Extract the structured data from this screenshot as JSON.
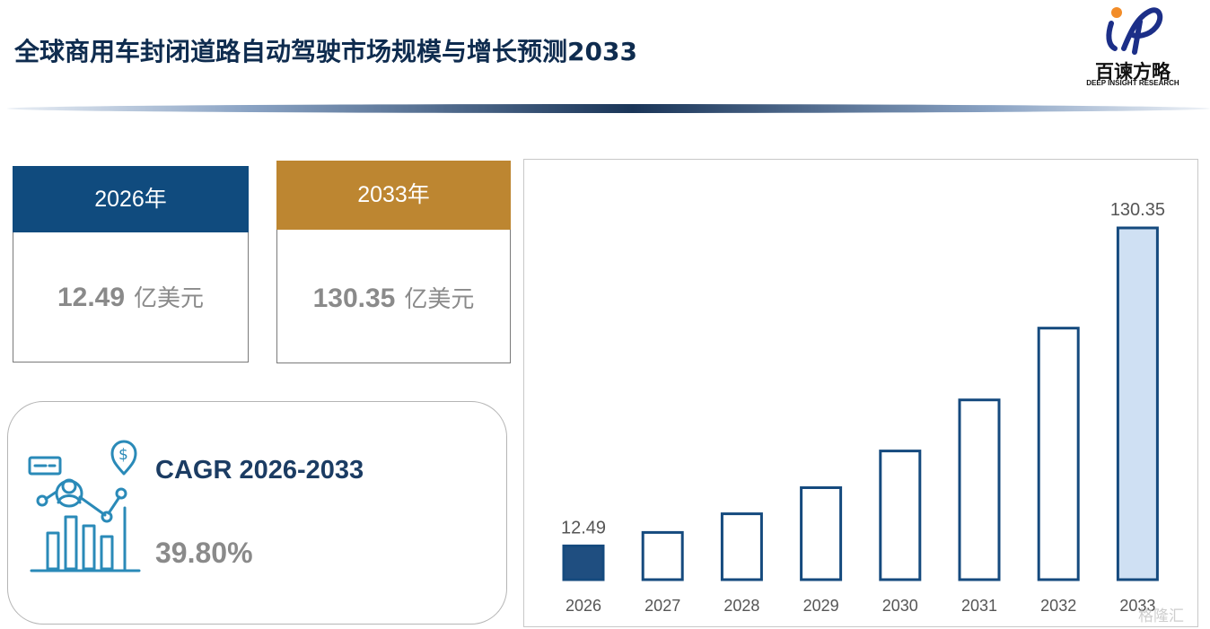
{
  "header": {
    "title": "全球商用车封闭道路自动驾驶市场规模与增长预测2033"
  },
  "logo": {
    "name_cn": "百谏方略",
    "name_en": "DEEP INSIGHT RESEARCH"
  },
  "cards": {
    "start": {
      "year_label": "2026年",
      "value": "12.49",
      "unit": "亿美元"
    },
    "end": {
      "year_label": "2033年",
      "value": "130.35",
      "unit": "亿美元"
    }
  },
  "cagr": {
    "label": "CAGR 2026-2033",
    "value": "39.80%"
  },
  "watermark": {
    "text": "格隆汇"
  },
  "colors": {
    "navy": "#104b7e",
    "gold": "#bd8631",
    "bar_outline": "#154a7e",
    "bar_first_fill": "#1f4e80",
    "bar_last_fill": "#cfe0f3",
    "value_gray": "#8a8a8a"
  },
  "chart_data": {
    "type": "bar",
    "categories": [
      "2026",
      "2027",
      "2028",
      "2029",
      "2030",
      "2031",
      "2032",
      "2033"
    ],
    "values": [
      12.49,
      17.5,
      24.4,
      34.1,
      47.7,
      66.6,
      93.2,
      130.35
    ],
    "data_labels": [
      "12.49",
      "",
      "",
      "",
      "",
      "",
      "",
      "130.35"
    ],
    "highlight": {
      "first": "filled-navy",
      "last": "filled-light-blue",
      "others": "outline"
    },
    "title": "",
    "xlabel": "",
    "ylabel": "",
    "ylim": [
      0,
      130.35
    ],
    "grid": false,
    "legend": "none"
  }
}
